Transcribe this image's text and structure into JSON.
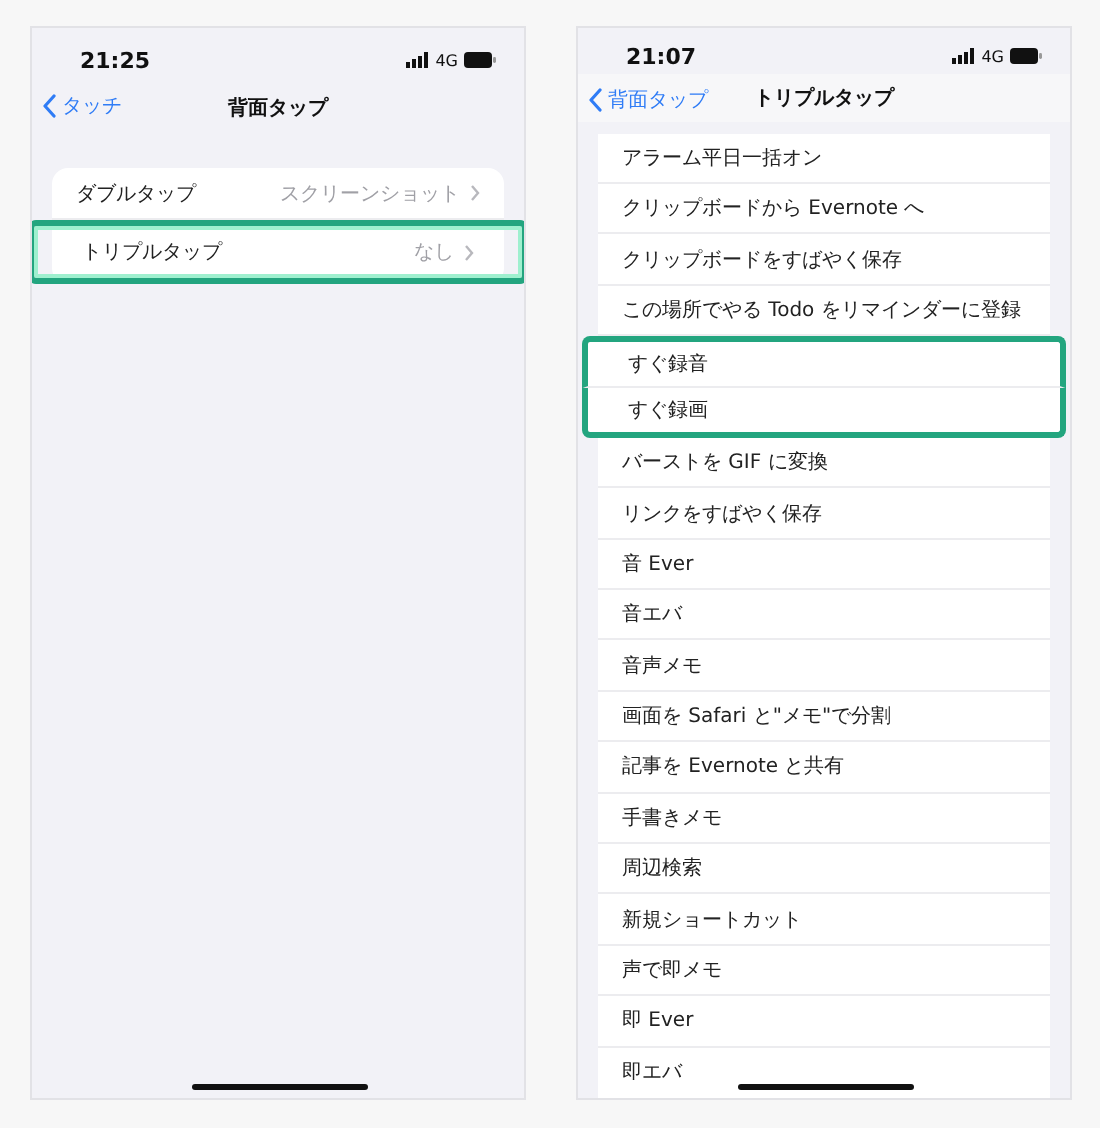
{
  "screens": [
    {
      "status_bar": {
        "time": "21:25",
        "network": "4G"
      },
      "nav": {
        "back": "タッチ",
        "title": "背面タップ"
      },
      "rows": [
        {
          "label": "ダブルタップ",
          "value": "スクリーンショット",
          "highlighted": false
        },
        {
          "label": "トリプルタップ",
          "value": "なし",
          "highlighted": true
        }
      ]
    },
    {
      "status_bar": {
        "time": "21:07",
        "network": "4G"
      },
      "nav": {
        "back": "背面タップ",
        "title": "トリプルタップ"
      },
      "rows": [
        {
          "label": "アラーム平日一括オン",
          "highlighted": false
        },
        {
          "label": "クリップボードから Evernote へ",
          "highlighted": false
        },
        {
          "label": "クリップボードをすばやく保存",
          "highlighted": false
        },
        {
          "label": "この場所でやる Todo をリマインダーに登録",
          "highlighted": false
        },
        {
          "label": "すぐ録音",
          "highlighted": true
        },
        {
          "label": "すぐ録画",
          "highlighted": true
        },
        {
          "label": "バーストを GIF に変換",
          "highlighted": false
        },
        {
          "label": "リンクをすばやく保存",
          "highlighted": false
        },
        {
          "label": "音 Ever",
          "highlighted": false
        },
        {
          "label": "音エバ",
          "highlighted": false
        },
        {
          "label": "音声メモ",
          "highlighted": false
        },
        {
          "label": "画面を Safari と\"メモ\"で分割",
          "highlighted": false
        },
        {
          "label": "記事を Evernote と共有",
          "highlighted": false
        },
        {
          "label": "手書きメモ",
          "highlighted": false
        },
        {
          "label": "周辺検索",
          "highlighted": false
        },
        {
          "label": "新規ショートカット",
          "highlighted": false
        },
        {
          "label": "声で即メモ",
          "highlighted": false
        },
        {
          "label": "即 Ever",
          "highlighted": false
        },
        {
          "label": "即エバ",
          "highlighted": false
        }
      ]
    }
  ]
}
